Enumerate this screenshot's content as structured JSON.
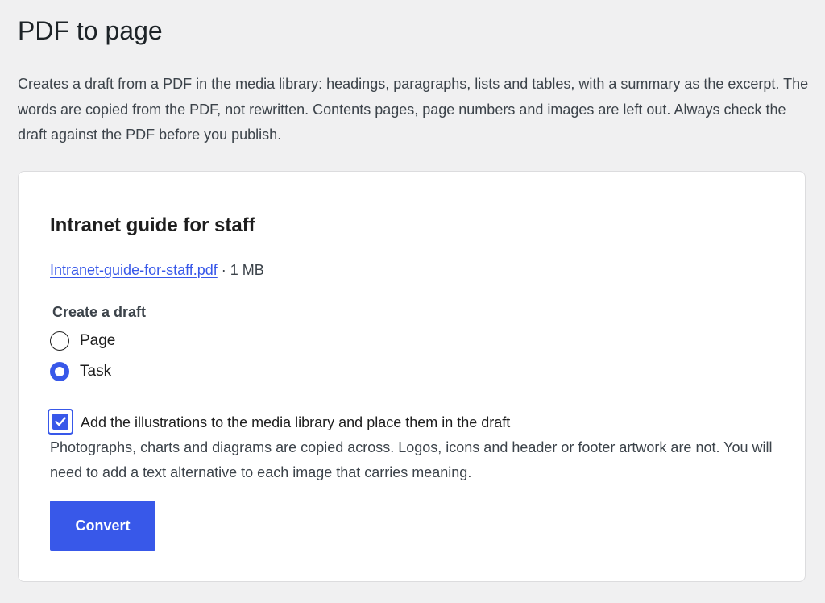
{
  "page": {
    "title": "PDF to page",
    "intro": "Creates a draft from a PDF in the media library: headings, paragraphs, lists and tables, with a summary as the excerpt. The words are copied from the PDF, not rewritten. Contents pages, page numbers and images are left out. Always check the draft against the PDF before you publish."
  },
  "card": {
    "title": "Intranet guide for staff",
    "file": {
      "name": "Intranet-guide-for-staff.pdf",
      "separator": " · ",
      "size": "1 MB"
    },
    "draft_type": {
      "legend": "Create a draft",
      "options": [
        {
          "label": "Page",
          "selected": false
        },
        {
          "label": "Task",
          "selected": true
        }
      ]
    },
    "illustrations": {
      "checked": true,
      "label": "Add the illustrations to the media library and place them in the draft",
      "help": "Photographs, charts and diagrams are copied across. Logos, icons and header or footer artwork are not. You will need to add a text alternative to each image that carries meaning."
    },
    "convert_label": "Convert"
  },
  "icons": {
    "checkbox_mark": "checkmark-icon"
  },
  "colors": {
    "accent": "#3858e9",
    "background": "#f0f0f1",
    "card": "#ffffff"
  }
}
